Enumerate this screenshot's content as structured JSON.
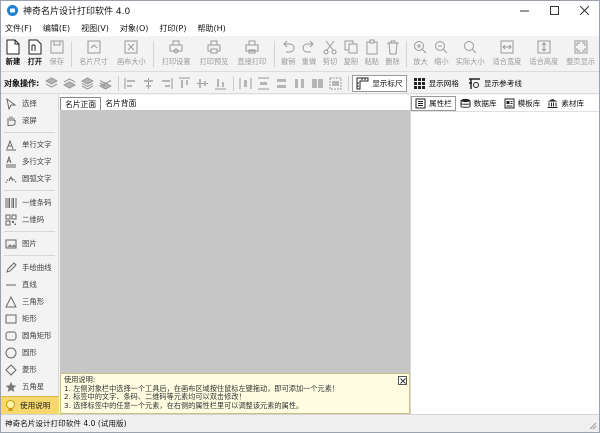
{
  "window": {
    "title": "神奇名片设计打印软件 4.0"
  },
  "menu": [
    "文件(F)",
    "编辑(E)",
    "视图(V)",
    "对象(O)",
    "打印(P)",
    "帮助(H)"
  ],
  "toolbar": [
    {
      "label": "新建",
      "icon": "new-file-icon",
      "state": "bold"
    },
    {
      "label": "打开",
      "icon": "open-icon",
      "state": "bold"
    },
    {
      "label": "保存",
      "icon": "save-icon",
      "state": "disabled"
    },
    {
      "label": "名片尺寸",
      "icon": "card-size-icon",
      "state": "disabled"
    },
    {
      "label": "画布大小",
      "icon": "canvas-size-icon",
      "state": "disabled"
    },
    {
      "label": "打印设置",
      "icon": "print-settings-icon",
      "state": "disabled"
    },
    {
      "label": "打印预览",
      "icon": "print-preview-icon",
      "state": "disabled"
    },
    {
      "label": "直接打印",
      "icon": "print-icon",
      "state": "disabled"
    },
    {
      "label": "撤销",
      "icon": "undo-icon",
      "state": "disabled"
    },
    {
      "label": "重做",
      "icon": "redo-icon",
      "state": "disabled"
    },
    {
      "label": "剪切",
      "icon": "cut-icon",
      "state": "disabled"
    },
    {
      "label": "复制",
      "icon": "copy-icon",
      "state": "disabled"
    },
    {
      "label": "粘贴",
      "icon": "paste-icon",
      "state": "disabled"
    },
    {
      "label": "删除",
      "icon": "delete-icon",
      "state": "disabled"
    },
    {
      "label": "放大",
      "icon": "zoom-in-icon",
      "state": "disabled"
    },
    {
      "label": "缩小",
      "icon": "zoom-out-icon",
      "state": "disabled"
    },
    {
      "label": "实际大小",
      "icon": "actual-size-icon",
      "state": "disabled"
    },
    {
      "label": "适合宽度",
      "icon": "fit-width-icon",
      "state": "disabled"
    },
    {
      "label": "适合高度",
      "icon": "fit-height-icon",
      "state": "disabled"
    },
    {
      "label": "整页显示",
      "icon": "full-page-icon",
      "state": "disabled"
    }
  ],
  "object_bar": {
    "label": "对象操作:",
    "show_ruler": "显示标尺",
    "show_grid": "显示网格",
    "show_guides": "显示参考线"
  },
  "tools": [
    "选择",
    "滚屏",
    "单行文字",
    "多行文字",
    "圆弧文字",
    "一维条码",
    "二维码",
    "图片",
    "手绘曲线",
    "直线",
    "三角形",
    "矩形",
    "圆角矩形",
    "圆形",
    "菱形",
    "五角星"
  ],
  "usage_button": "使用说明",
  "canvas_tabs": [
    "名片正面",
    "名片背面"
  ],
  "help": {
    "title": "使用说明:",
    "lines": [
      "1. 左侧对象栏中选择一个工具后，在画布区域按住鼠标左键拖动，即可添加一个元素！",
      "2. 标签中的文字、条码、二维码等元素均可以双击修改！",
      "3. 选择标签中的任意一个元素，在右侧的属性栏里可以调整该元素的属性。"
    ]
  },
  "right_tabs": [
    "属性栏",
    "数据库",
    "模板库",
    "素材库"
  ],
  "status": "神奇名片设计打印软件 4.0 (试用版)",
  "colors": {
    "accent": "#1a7fd6",
    "canvas_gray": "#c6c6c6",
    "help_bg": "#fffde1",
    "usage_bg": "#f7d86c"
  }
}
